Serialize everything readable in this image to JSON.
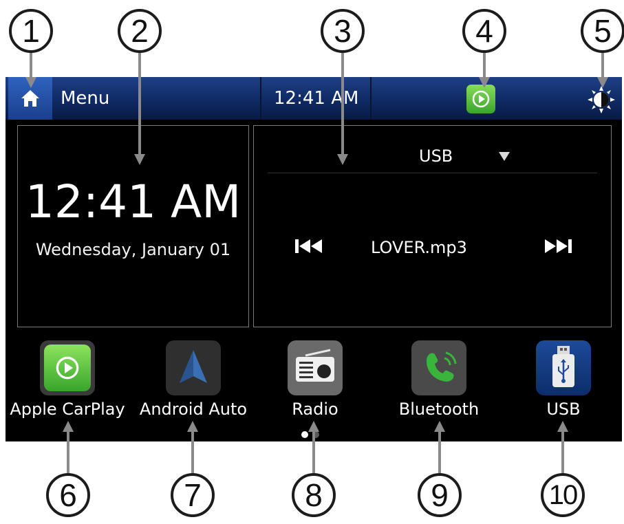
{
  "topbar": {
    "menu_label": "Menu",
    "clock": "12:41 AM",
    "icons": [
      "home-icon",
      "carplay-icon",
      "brightness-icon"
    ]
  },
  "clock_panel": {
    "time": "12:41 AM",
    "date": "Wednesday, January 01"
  },
  "media_panel": {
    "source": "USB",
    "track": "LOVER.mp3",
    "icons": [
      "source-dropdown-icon",
      "previous-track-icon",
      "next-track-icon"
    ]
  },
  "apps": [
    {
      "label": "Apple CarPlay",
      "icon": "carplay-icon"
    },
    {
      "label": "Android Auto",
      "icon": "android-auto-icon"
    },
    {
      "label": "Radio",
      "icon": "radio-icon"
    },
    {
      "label": "Bluetooth",
      "icon": "bluetooth-phone-icon"
    },
    {
      "label": "USB",
      "icon": "usb-icon"
    }
  ],
  "pager": {
    "pages": 2,
    "current": 1
  },
  "callouts": [
    "1",
    "2",
    "3",
    "4",
    "5",
    "6",
    "7",
    "8",
    "9",
    "10"
  ],
  "colors": {
    "topbar": "#0f2a63",
    "carplay_green": "#4fbf3a",
    "screen_bg": "#000000"
  }
}
